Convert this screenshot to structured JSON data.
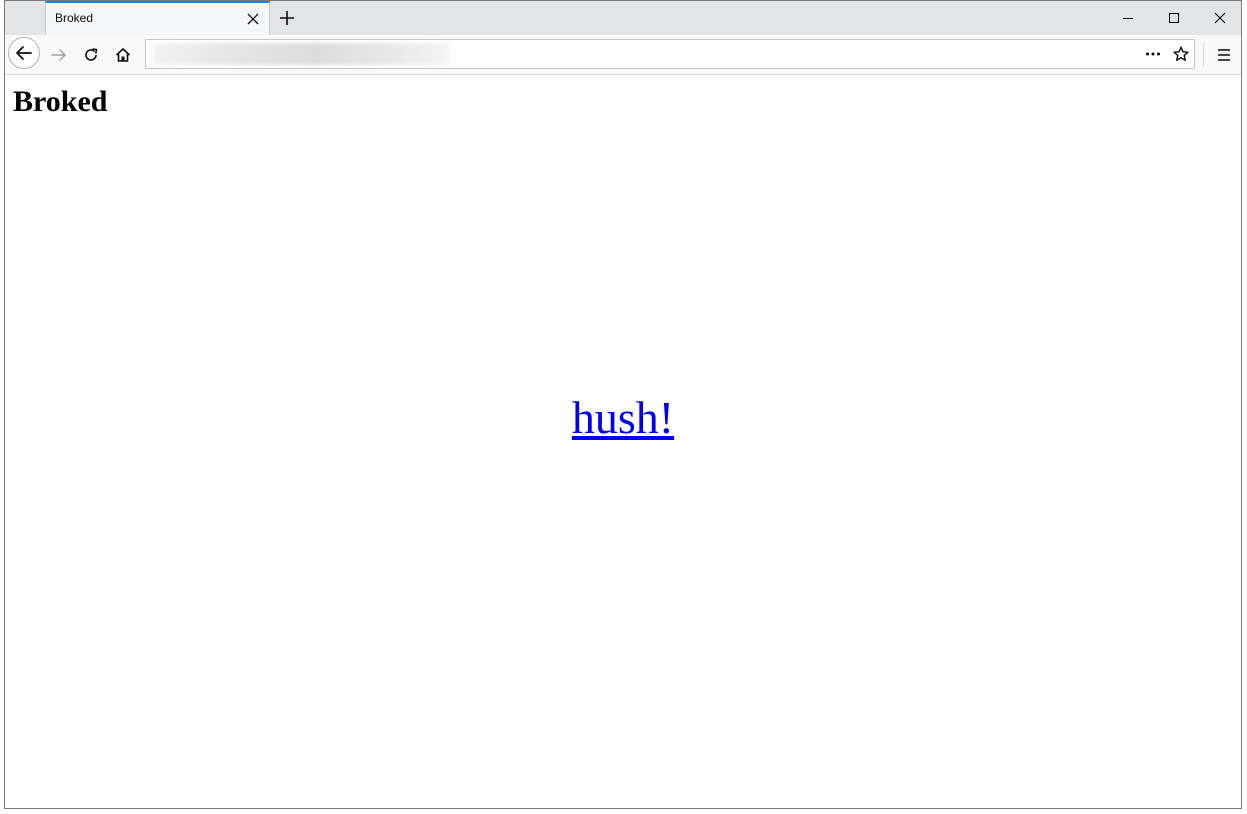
{
  "browser": {
    "tab": {
      "title": "Broked"
    },
    "address_bar": {
      "url": ""
    },
    "colors": {
      "tab_accent": "#0a84ff",
      "link": "#0000ee"
    }
  },
  "icons": {
    "tab_close": "close-icon",
    "new_tab": "plus-icon",
    "minimize": "minimize-icon",
    "maximize": "maximize-icon",
    "close_window": "close-icon",
    "back": "arrow-left-icon",
    "forward": "arrow-right-icon",
    "reload": "reload-icon",
    "home": "home-icon",
    "page_actions": "more-horizontal-icon",
    "bookmark": "star-icon",
    "menu": "hamburger-menu-icon"
  },
  "page": {
    "heading": "Broked",
    "center_link": "hush!"
  }
}
